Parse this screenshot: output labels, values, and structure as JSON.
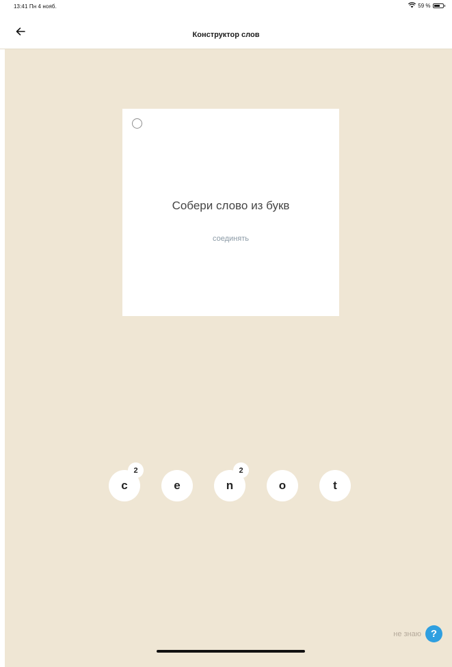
{
  "status_bar": {
    "time": "13:41  Пн 4 нояб.",
    "battery": "59 %",
    "battery_level": 0.59
  },
  "nav": {
    "title": "Конструктор слов"
  },
  "card": {
    "prompt": "Собери слово из букв",
    "hint": "соединять"
  },
  "tiles": [
    {
      "letter": "c",
      "count": "2"
    },
    {
      "letter": "e",
      "count": ""
    },
    {
      "letter": "n",
      "count": "2"
    },
    {
      "letter": "o",
      "count": ""
    },
    {
      "letter": "t",
      "count": ""
    }
  ],
  "footer": {
    "dont_know_label": "не знаю",
    "help_glyph": "?"
  },
  "icons": {
    "back": "arrow-left-icon",
    "wifi": "wifi-icon",
    "battery": "battery-icon",
    "help": "question-mark-icon",
    "radio": "radio-circle-icon"
  },
  "colors": {
    "background": "#efe6d4",
    "accent": "#2f9fe0",
    "hint": "#8b9aa6"
  }
}
